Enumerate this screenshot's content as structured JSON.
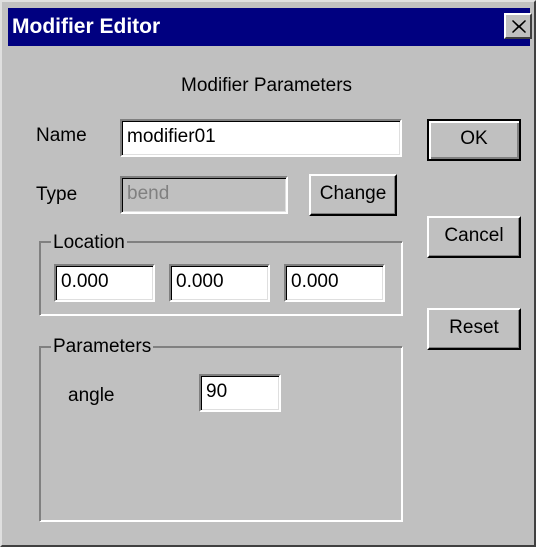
{
  "window": {
    "title": "Modifier Editor"
  },
  "heading": "Modifier Parameters",
  "name": {
    "label": "Name",
    "value": "modifier01"
  },
  "type": {
    "label": "Type",
    "value": "bend",
    "change_label": "Change"
  },
  "location": {
    "label": "Location",
    "values": [
      "0.000",
      "0.000",
      "0.000"
    ]
  },
  "parameters": {
    "label": "Parameters",
    "items": [
      {
        "label": "angle",
        "value": "90"
      }
    ]
  },
  "buttons": {
    "ok": "OK",
    "cancel": "Cancel",
    "reset": "Reset"
  },
  "icons": {
    "close": "close-icon"
  },
  "colors": {
    "titlebar": "#000080",
    "face": "#c0c0c0",
    "disabled_text": "#808080"
  }
}
